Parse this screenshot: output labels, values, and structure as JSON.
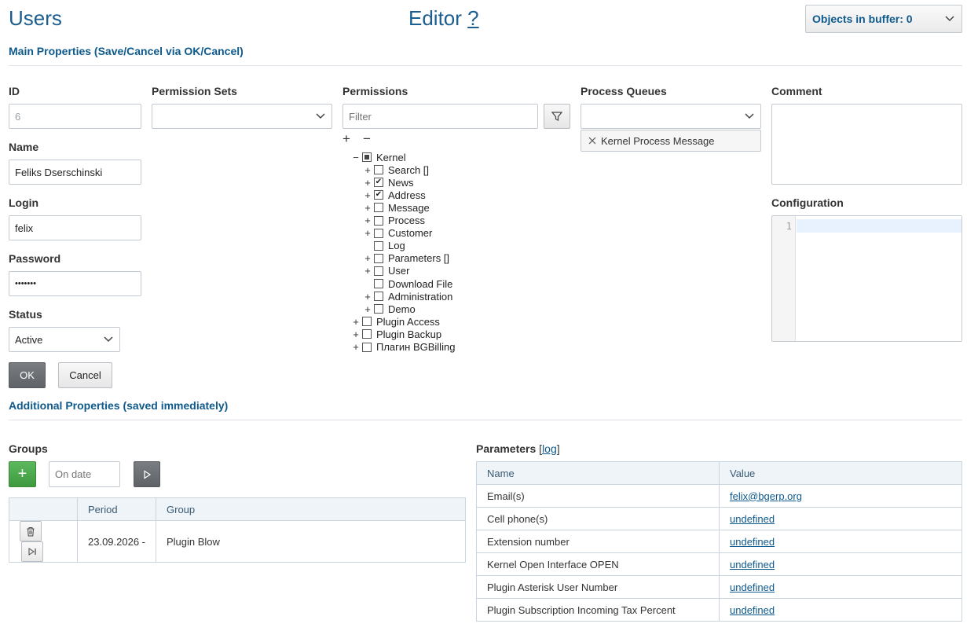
{
  "header": {
    "title": "Users",
    "editor_label": "Editor",
    "help_label": "?",
    "buffer_label": "Objects in buffer: 0"
  },
  "main_section": {
    "title": "Main Properties (Save/Cancel via OK/Cancel)"
  },
  "form": {
    "id_label": "ID",
    "id_value": "6",
    "name_label": "Name",
    "name_value": "Feliks Dserschinski",
    "login_label": "Login",
    "login_value": "felix",
    "password_label": "Password",
    "password_value": "•••••••",
    "status_label": "Status",
    "status_value": "Active",
    "ok_label": "OK",
    "cancel_label": "Cancel"
  },
  "permission_sets": {
    "label": "Permission Sets",
    "value": ""
  },
  "permissions": {
    "label": "Permissions",
    "filter_placeholder": "Filter",
    "expand_all": "+",
    "collapse_all": "−",
    "tree": [
      {
        "label": "Kernel",
        "toggle": "−",
        "level": 0,
        "state": "partial"
      },
      {
        "label": "Search []",
        "toggle": "+",
        "level": 1,
        "state": "unchecked"
      },
      {
        "label": "News",
        "toggle": "+",
        "level": 1,
        "state": "checked"
      },
      {
        "label": "Address",
        "toggle": "+",
        "level": 1,
        "state": "checked"
      },
      {
        "label": "Message",
        "toggle": "+",
        "level": 1,
        "state": "unchecked"
      },
      {
        "label": "Process",
        "toggle": "+",
        "level": 1,
        "state": "unchecked"
      },
      {
        "label": "Customer",
        "toggle": "+",
        "level": 1,
        "state": "unchecked"
      },
      {
        "label": "Log",
        "toggle": "",
        "level": 1,
        "state": "unchecked"
      },
      {
        "label": "Parameters []",
        "toggle": "+",
        "level": 1,
        "state": "unchecked"
      },
      {
        "label": "User",
        "toggle": "+",
        "level": 1,
        "state": "unchecked"
      },
      {
        "label": "Download File",
        "toggle": "",
        "level": 1,
        "state": "unchecked"
      },
      {
        "label": "Administration",
        "toggle": "+",
        "level": 1,
        "state": "unchecked"
      },
      {
        "label": "Demo",
        "toggle": "+",
        "level": 1,
        "state": "unchecked"
      },
      {
        "label": "Plugin Access",
        "toggle": "+",
        "level": 0,
        "state": "unchecked"
      },
      {
        "label": "Plugin Backup",
        "toggle": "+",
        "level": 0,
        "state": "unchecked"
      },
      {
        "label": "Плагин BGBilling",
        "toggle": "+",
        "level": 0,
        "state": "unchecked"
      }
    ]
  },
  "process_queues": {
    "label": "Process Queues",
    "selected": "Kernel Process Message"
  },
  "comment": {
    "label": "Comment",
    "value": ""
  },
  "configuration": {
    "label": "Configuration",
    "line_number": "1"
  },
  "additional_section": {
    "title": "Additional Properties (saved immediately)"
  },
  "groups": {
    "label": "Groups",
    "add_label": "+",
    "date_placeholder": "On date",
    "columns": [
      "",
      "Period",
      "Group"
    ],
    "rows": [
      {
        "period": "23.09.2026 -",
        "group": "Plugin Blow"
      }
    ]
  },
  "parameters": {
    "label": "Parameters",
    "log_link": "log",
    "columns": [
      "Name",
      "Value"
    ],
    "rows": [
      {
        "name": "Email(s)",
        "value": "felix@bgerp.org"
      },
      {
        "name": "Cell phone(s)",
        "value": "undefined"
      },
      {
        "name": "Extension number",
        "value": "undefined"
      },
      {
        "name": "Kernel Open Interface OPEN",
        "value": "undefined"
      },
      {
        "name": "Plugin Asterisk User Number",
        "value": "undefined"
      },
      {
        "name": "Plugin Subscription Incoming Tax Percent",
        "value": "undefined"
      }
    ]
  },
  "colors": {
    "accent": "#0f5a8c",
    "title": "#1b5e8f",
    "green_button": "#4cae4c",
    "dark_button": "#6b6e73"
  }
}
